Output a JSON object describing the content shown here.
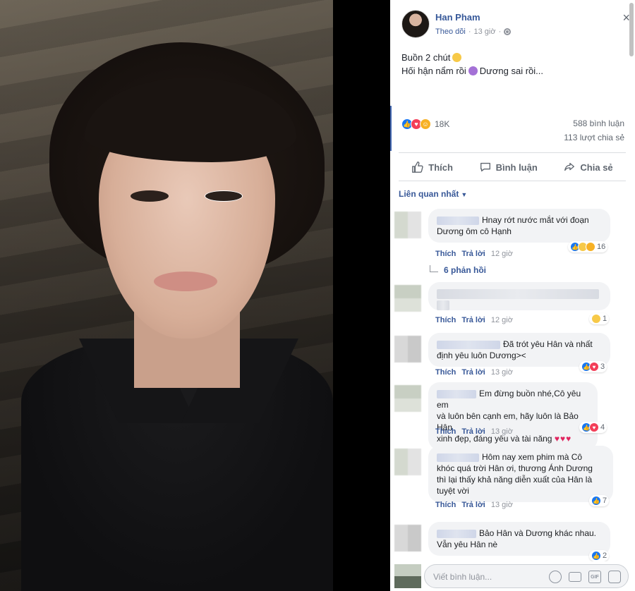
{
  "post": {
    "author": "Han Pham",
    "follow": "Theo dõi",
    "dot": "·",
    "time": "13 giờ",
    "close": "×",
    "line1": "Buồn 2 chút",
    "line2a": "Hối hận nẩm rồi",
    "line2b": "Dương sai rồi..."
  },
  "stats": {
    "reactions": "18K",
    "comments": "588 bình luận",
    "shares": "113 lượt chia sẻ"
  },
  "actions": {
    "like": "Thích",
    "comment": "Bình luận",
    "share": "Chia sẻ"
  },
  "sort": {
    "label": "Liên quan nhất",
    "caret": "▼"
  },
  "comment_actions": {
    "like": "Thích",
    "reply": "Trả lời"
  },
  "comments": [
    {
      "text": "Hnay rớt nước mắt với đoạn Dương ôm cô Hạnh",
      "line1": "Hnay rớt nước mắt với đoạn",
      "line2": "Dương ôm cô Hạnh",
      "time": "12 giờ",
      "reactions": "16"
    },
    {
      "time": "12 giờ",
      "reactions": "1"
    },
    {
      "line1": "Đã trót yêu Hân và nhất",
      "line2": "định yêu luôn Dương><",
      "time": "13 giờ",
      "reactions": "3"
    },
    {
      "line1": "Em đừng buồn nhé,Cô yêu em",
      "line2": "và luôn bên cạnh em, hãy luôn là Bảo Hân",
      "line3": "xinh đẹp, đáng yêu và tài năng",
      "hearts": "♥♥♥",
      "time": "13 giờ",
      "reactions": "4"
    },
    {
      "line1": "Hôm nay xem phim mà Cô",
      "line2": "khóc quá trời Hân ơi, thương Ánh Dương",
      "line3": "thì lại thấy khả năng diễn xuất của Hân là",
      "line4": "tuyệt vời",
      "time": "13 giờ",
      "reactions": "7"
    },
    {
      "line1": "Bảo Hân và Dương khác nhau.",
      "line2": "Vẫn yêu Hân nè",
      "reactions": "2"
    }
  ],
  "replies": {
    "label": "6 phản hồi"
  },
  "compose": {
    "placeholder": "Viết bình luận...",
    "gif": "GIF"
  },
  "colors": {
    "link": "#385898",
    "like": "#1877f2",
    "love": "#f33e58"
  }
}
